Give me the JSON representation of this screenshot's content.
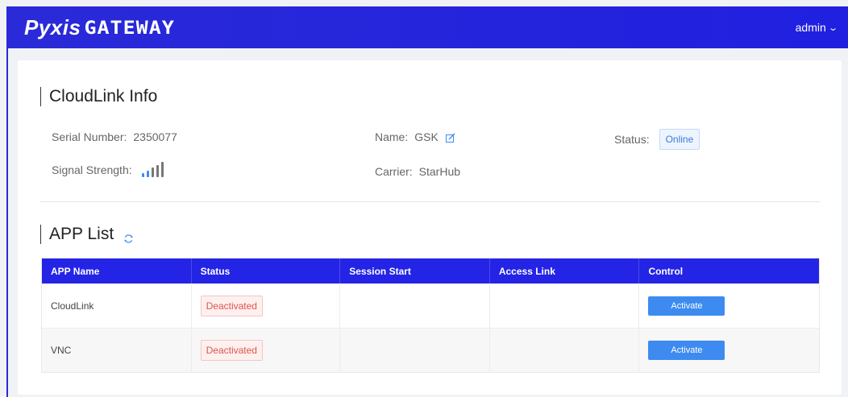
{
  "brand": {
    "logo_italic": "Pyxis",
    "logo_block": "GATEWAY"
  },
  "user_menu": {
    "label": "admin"
  },
  "cloudlink": {
    "title": "CloudLink Info",
    "serial_label": "Serial Number:",
    "serial_value": "2350077",
    "name_label": "Name:",
    "name_value": "GSK",
    "status_label": "Status:",
    "status_value": "Online",
    "signal_label": "Signal Strength:",
    "signal_level": 2,
    "signal_max": 5,
    "carrier_label": "Carrier:",
    "carrier_value": "StarHub"
  },
  "app_list": {
    "title": "APP List",
    "columns": [
      "APP Name",
      "Status",
      "Session Start",
      "Access Link",
      "Control"
    ],
    "rows": [
      {
        "name": "CloudLink",
        "status": "Deactivated",
        "session_start": "",
        "access_link": "",
        "control": "Activate"
      },
      {
        "name": "VNC",
        "status": "Deactivated",
        "session_start": "",
        "access_link": "",
        "control": "Activate"
      }
    ]
  },
  "colors": {
    "header_bg": "#2a2ad8",
    "table_header_bg": "#2424e6",
    "accent_blue": "#3d8bf0",
    "deactivated_red": "#e0544c"
  }
}
